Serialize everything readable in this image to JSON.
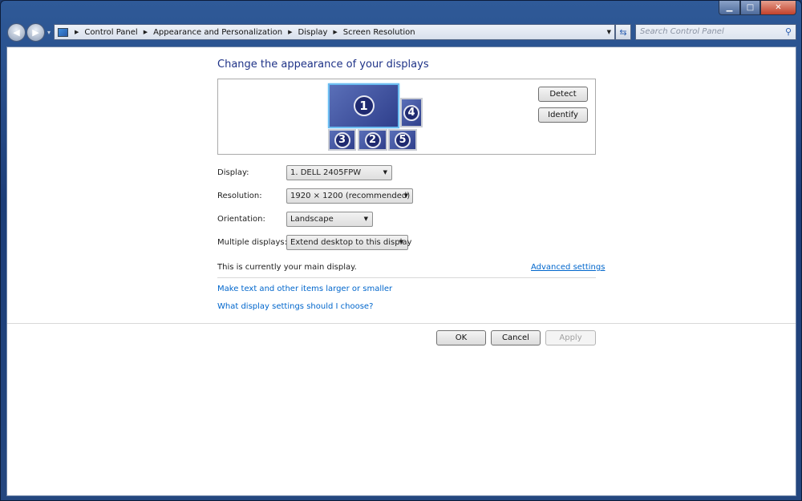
{
  "window": {
    "minimize": "▁",
    "maximize": "□",
    "close": "✕"
  },
  "nav": {
    "back": "◀",
    "forward": "▶",
    "dropdown": "▾",
    "breadcrumbs": [
      "Control Panel",
      "Appearance and Personalization",
      "Display",
      "Screen Resolution"
    ],
    "refresh": "⇆"
  },
  "search": {
    "placeholder": "Search Control Panel",
    "icon": "⚲"
  },
  "main": {
    "title": "Change the appearance of your displays",
    "monitors": [
      "1",
      "4",
      "3",
      "2",
      "5"
    ],
    "detect": "Detect",
    "identify": "Identify",
    "display_label": "Display:",
    "display_value": "1. DELL 2405FPW",
    "resolution_label": "Resolution:",
    "resolution_value": "1920 × 1200 (recommended)",
    "orientation_label": "Orientation:",
    "orientation_value": "Landscape",
    "multiple_label": "Multiple displays:",
    "multiple_value": "Extend desktop to this display",
    "main_display_text": "This is currently your main display.",
    "advanced": "Advanced settings",
    "link_text_size": "Make text and other items larger or smaller",
    "link_help": "What display settings should I choose?",
    "ok": "OK",
    "cancel": "Cancel",
    "apply": "Apply"
  }
}
